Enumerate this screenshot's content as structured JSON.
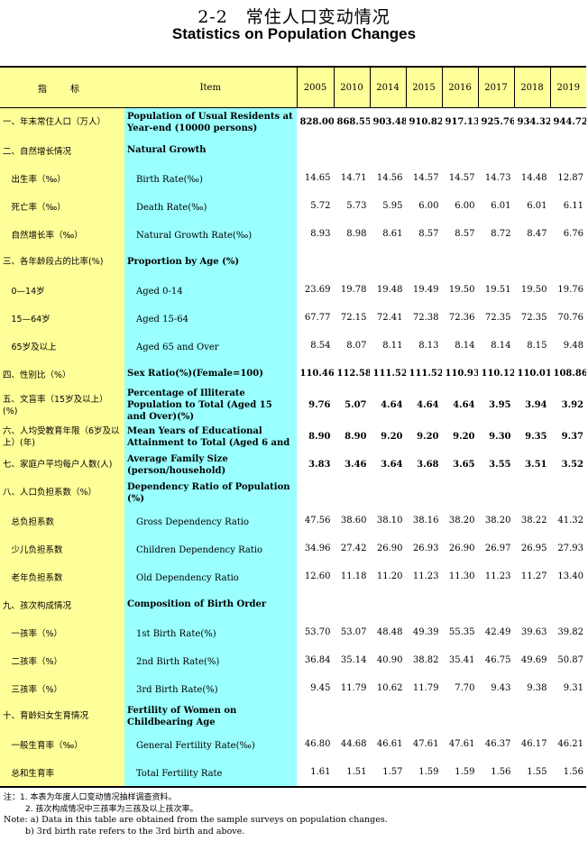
{
  "title_cn": "2-2　常住人口变动情况",
  "title_en": "Statistics on Population Changes",
  "header": {
    "indicator": "指　标",
    "item": "Item",
    "years": [
      "2005",
      "2010",
      "2014",
      "2015",
      "2016",
      "2017",
      "2018",
      "2019"
    ]
  },
  "rows": [
    {
      "cn": "一、年末常住人口（万人）",
      "en": "Population of Usual Residents at Year-end (10000 persons)",
      "values": [
        "828.00",
        "868.55",
        "903.48",
        "910.82",
        "917.13",
        "925.76",
        "934.32",
        "944.72"
      ],
      "bold": true
    },
    {
      "cn": "二、自然增长情况",
      "en": "Natural Growth",
      "values": [
        "",
        "",
        "",
        "",
        "",
        "",
        "",
        ""
      ],
      "bold": true
    },
    {
      "cn": "　出生率（‰）",
      "en": "　Birth Rate(‰)",
      "values": [
        "14.65",
        "14.71",
        "14.56",
        "14.57",
        "14.57",
        "14.73",
        "14.48",
        "12.87"
      ],
      "bold": false
    },
    {
      "cn": "　死亡率（‰）",
      "en": "　Death Rate(‰)",
      "values": [
        "5.72",
        "5.73",
        "5.95",
        "6.00",
        "6.00",
        "6.01",
        "6.01",
        "6.11"
      ],
      "bold": false
    },
    {
      "cn": "　自然增长率（‰）",
      "en": "　Natural Growth Rate(‰)",
      "values": [
        "8.93",
        "8.98",
        "8.61",
        "8.57",
        "8.57",
        "8.72",
        "8.47",
        "6.76"
      ],
      "bold": false
    },
    {
      "cn": "三、各年龄段占的比率(%)",
      "en": "Proportion by Age (%)",
      "values": [
        "",
        "",
        "",
        "",
        "",
        "",
        "",
        ""
      ],
      "bold": true
    },
    {
      "cn": "　0—14岁",
      "en": "　Aged 0-14",
      "values": [
        "23.69",
        "19.78",
        "19.48",
        "19.49",
        "19.50",
        "19.51",
        "19.50",
        "19.76"
      ],
      "bold": false
    },
    {
      "cn": "　15—64岁",
      "en": "　Aged 15-64",
      "values": [
        "67.77",
        "72.15",
        "72.41",
        "72.38",
        "72.36",
        "72.35",
        "72.35",
        "70.76"
      ],
      "bold": false
    },
    {
      "cn": "　65岁及以上",
      "en": "　Aged 65 and Over",
      "values": [
        "8.54",
        "8.07",
        "8.11",
        "8.13",
        "8.14",
        "8.14",
        "8.15",
        "9.48"
      ],
      "bold": false
    },
    {
      "cn": "四、性别比（%）",
      "en": "Sex Ratio(%)(Female=100)",
      "values": [
        "110.46",
        "112.58",
        "111.52",
        "111.52",
        "110.93",
        "110.12",
        "110.01",
        "108.86"
      ],
      "bold": true
    },
    {
      "cn": "五、文盲率（15岁及以上）(%)",
      "en": "Percentage of Illiterate Population to Total (Aged 15 and Over)(%)",
      "values": [
        "9.76",
        "5.07",
        "4.64",
        "4.64",
        "4.64",
        "3.95",
        "3.94",
        "3.92"
      ],
      "bold": true
    },
    {
      "cn": "六、人均受教育年限（6岁及以上）(年)",
      "en": "Mean Years of Educational Attainment to Total (Aged 6 and",
      "values": [
        "8.90",
        "8.90",
        "9.20",
        "9.20",
        "9.20",
        "9.30",
        "9.35",
        "9.37"
      ],
      "bold": true
    },
    {
      "cn": "七、家庭户平均每户人数(人)",
      "en": "Average Family Size (person/household)",
      "values": [
        "3.83",
        "3.46",
        "3.64",
        "3.68",
        "3.65",
        "3.55",
        "3.51",
        "3.52"
      ],
      "bold": true
    },
    {
      "cn": "八、人口负担系数（%）",
      "en": "Dependency Ratio of Population (%)",
      "values": [
        "",
        "",
        "",
        "",
        "",
        "",
        "",
        ""
      ],
      "bold": true
    },
    {
      "cn": "　总负担系数",
      "en": "　Gross Dependency Ratio",
      "values": [
        "47.56",
        "38.60",
        "38.10",
        "38.16",
        "38.20",
        "38.20",
        "38.22",
        "41.32"
      ],
      "bold": false
    },
    {
      "cn": "　少儿负担系数",
      "en": "　Children Dependency Ratio",
      "values": [
        "34.96",
        "27.42",
        "26.90",
        "26.93",
        "26.90",
        "26.97",
        "26.95",
        "27.93"
      ],
      "bold": false
    },
    {
      "cn": "　老年负担系数",
      "en": "　Old Dependency Ratio",
      "values": [
        "12.60",
        "11.18",
        "11.20",
        "11.23",
        "11.30",
        "11.23",
        "11.27",
        "13.40"
      ],
      "bold": false
    },
    {
      "cn": "九、孩次构成情况",
      "en": "Composition of Birth Order",
      "values": [
        "",
        "",
        "",
        "",
        "",
        "",
        "",
        ""
      ],
      "bold": true
    },
    {
      "cn": "　一孩率（%）",
      "en": "　1st Birth Rate(%)",
      "values": [
        "53.70",
        "53.07",
        "48.48",
        "49.39",
        "55.35",
        "42.49",
        "39.63",
        "39.82"
      ],
      "bold": false
    },
    {
      "cn": "　二孩率（%）",
      "en": "　2nd Birth Rate(%)",
      "values": [
        "36.84",
        "35.14",
        "40.90",
        "38.82",
        "35.41",
        "46.75",
        "49.69",
        "50.87"
      ],
      "bold": false
    },
    {
      "cn": "　三孩率（%）",
      "en": "　3rd Birth Rate(%)",
      "values": [
        "9.45",
        "11.79",
        "10.62",
        "11.79",
        "7.70",
        "9.43",
        "9.38",
        "9.31"
      ],
      "bold": false
    },
    {
      "cn": "十、育龄妇女生育情况",
      "en": "Fertility of Women on Childbearing Age",
      "values": [
        "",
        "",
        "",
        "",
        "",
        "",
        "",
        ""
      ],
      "bold": true
    },
    {
      "cn": "　一般生育率（‰）",
      "en": "　General Fertility Rate(‰)",
      "values": [
        "46.80",
        "44.68",
        "46.61",
        "47.61",
        "47.61",
        "46.37",
        "46.17",
        "46.21"
      ],
      "bold": false
    },
    {
      "cn": "　总和生育率",
      "en": "　Total Fertility Rate",
      "values": [
        "1.61",
        "1.51",
        "1.57",
        "1.59",
        "1.59",
        "1.56",
        "1.55",
        "1.56"
      ],
      "bold": false
    }
  ],
  "notes": {
    "cn1": "注：1. 本表为年度人口变动情况抽样调查资料。",
    "cn2": "2. 孩次构成情况中三孩率为三孩及以上孩次率。",
    "en1": "Note: a) Data in this table are obtained from the sample surveys on population changes.",
    "en2": "b) 3rd birth rate refers to the 3rd birth and above."
  },
  "colors": {
    "indicator_bg": "#ffff99",
    "item_bg": "#99ffff"
  }
}
